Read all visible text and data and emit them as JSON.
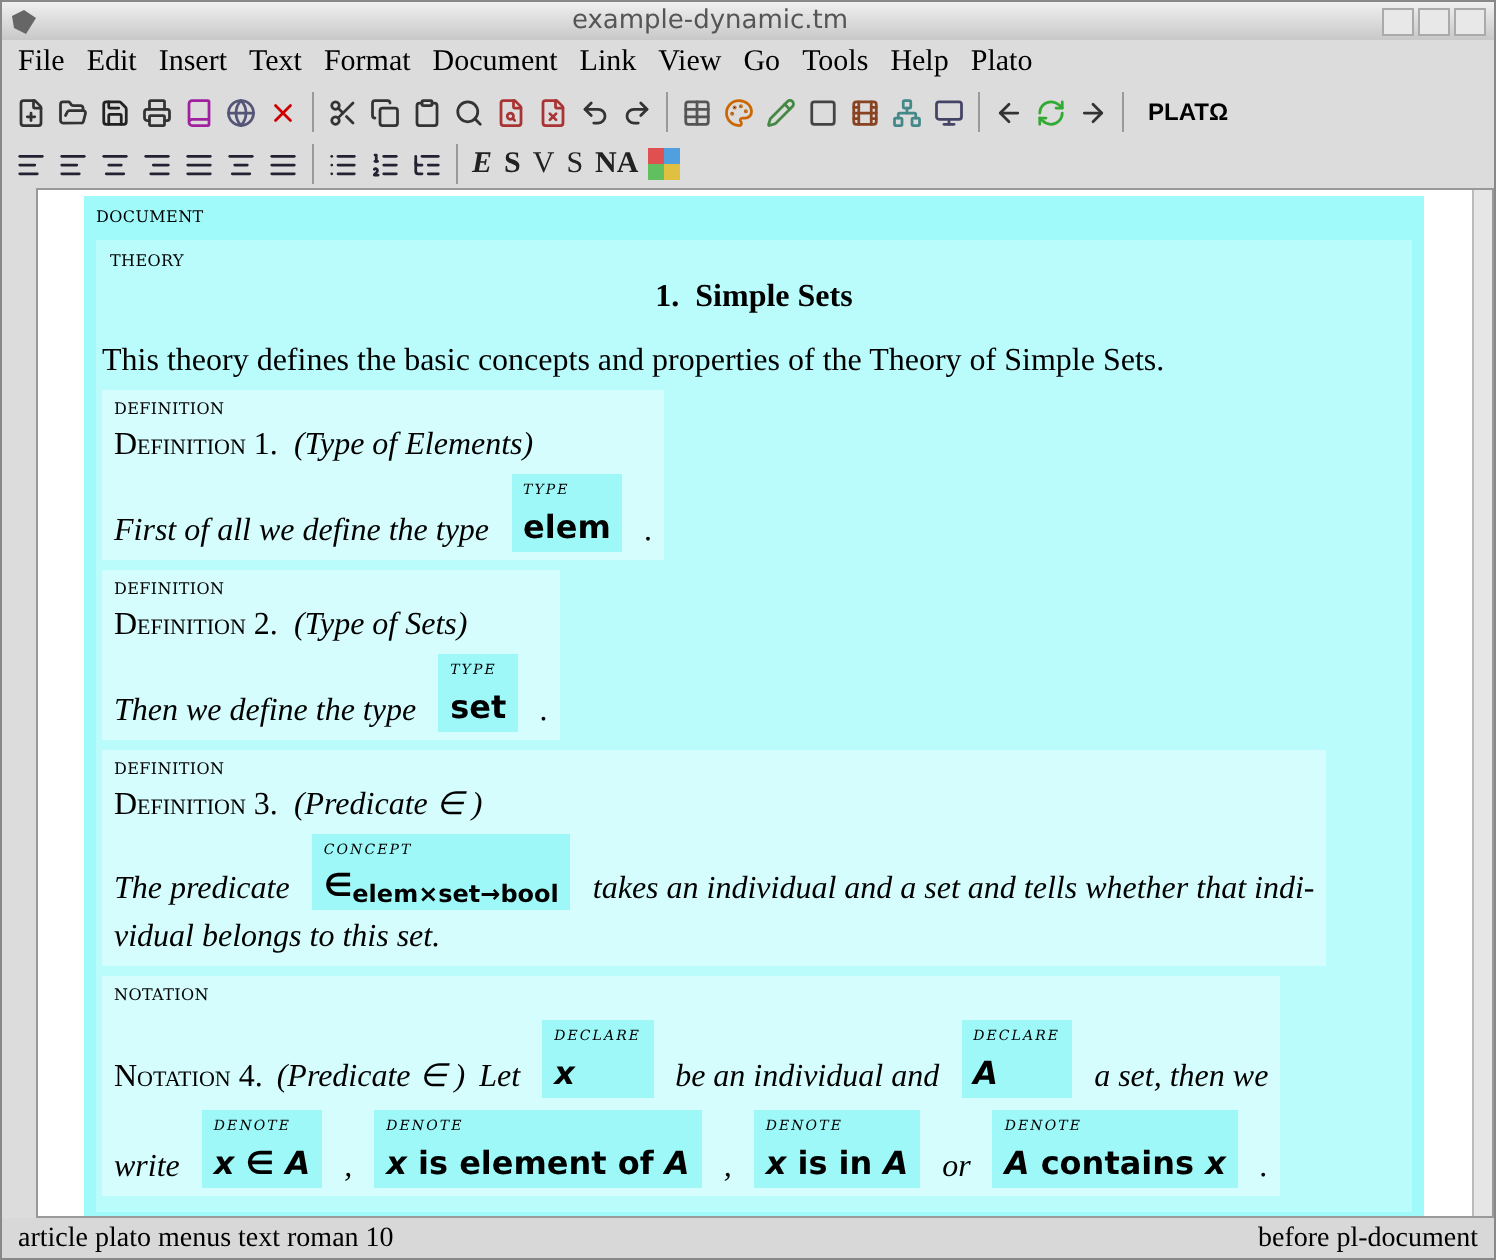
{
  "window": {
    "title": "example-dynamic.tm"
  },
  "menu": [
    "File",
    "Edit",
    "Insert",
    "Text",
    "Format",
    "Document",
    "Link",
    "View",
    "Go",
    "Tools",
    "Help",
    "Plato"
  ],
  "toolbar": {
    "plato_label": "PLATΩ"
  },
  "format_bar": {
    "style_buttons": [
      {
        "label": "E",
        "kind": "italic"
      },
      {
        "label": "S",
        "kind": "bold"
      },
      {
        "label": "V",
        "kind": "plain"
      },
      {
        "label": "S",
        "kind": "plain"
      },
      {
        "label": "NA",
        "kind": "smallcap"
      }
    ]
  },
  "document": {
    "label": "DOCUMENT",
    "theory": {
      "label": "THEORY",
      "title": "1.  Simple Sets",
      "intro": "This theory defines the basic concepts and properties of the Theory of Simple Sets.",
      "blocks": [
        {
          "kind": "definition",
          "tag": "DEFINITION",
          "heading": "Definition 1.",
          "subtitle": "(Type of Elements)",
          "lines": [
            [
              {
                "kind": "text",
                "text": "First of all we define the type"
              },
              {
                "kind": "box",
                "tag": "TYPE",
                "value": "elem"
              },
              {
                "kind": "text",
                "text": "."
              }
            ]
          ]
        },
        {
          "kind": "definition",
          "tag": "DEFINITION",
          "heading": "Definition 2.",
          "subtitle": "(Type of Sets)",
          "lines": [
            [
              {
                "kind": "text",
                "text": "Then we define the type"
              },
              {
                "kind": "box",
                "tag": "TYPE",
                "value": "set"
              },
              {
                "kind": "text",
                "text": "."
              }
            ]
          ]
        },
        {
          "kind": "definition",
          "tag": "DEFINITION",
          "heading": "Definition 3.",
          "subtitle": "(Predicate ∈ )",
          "lines": [
            [
              {
                "kind": "text",
                "text": "The predicate"
              },
              {
                "kind": "box",
                "tag": "CONCEPT",
                "value": "∈$_{elem×set→bool}$"
              },
              {
                "kind": "text",
                "text": "takes an individual and a set and tells whether that indi-"
              }
            ],
            [
              {
                "kind": "text",
                "text": "vidual belongs to this set."
              }
            ]
          ]
        },
        {
          "kind": "notation",
          "tag": "NOTATION",
          "heading": "Notation 4.",
          "subtitle": "(Predicate  ∈ )",
          "lines": [
            [
              {
                "kind": "text",
                "text": "Let"
              },
              {
                "kind": "box",
                "tag": "DECLARE",
                "value": "*x*"
              },
              {
                "kind": "text",
                "text": "be an individual and"
              },
              {
                "kind": "box",
                "tag": "DECLARE",
                "value": "*A*"
              },
              {
                "kind": "text",
                "text": "a set, then we"
              }
            ],
            [
              {
                "kind": "text",
                "text": "write"
              },
              {
                "kind": "box",
                "tag": "DENOTE",
                "value": "*x* ∈ *A*"
              },
              {
                "kind": "text",
                "text": ","
              },
              {
                "kind": "box",
                "tag": "DENOTE",
                "value": "*x* is element of *A*"
              },
              {
                "kind": "text",
                "text": ","
              },
              {
                "kind": "box",
                "tag": "DENOTE",
                "value": "*x* is in *A*"
              },
              {
                "kind": "text",
                "text": "or"
              },
              {
                "kind": "box",
                "tag": "DENOTE",
                "value": "*A* contains *x*"
              },
              {
                "kind": "text",
                "text": "."
              }
            ]
          ]
        }
      ]
    }
  },
  "status_bar": {
    "left": "article plato menus text roman 10",
    "right": "before pl-document"
  }
}
